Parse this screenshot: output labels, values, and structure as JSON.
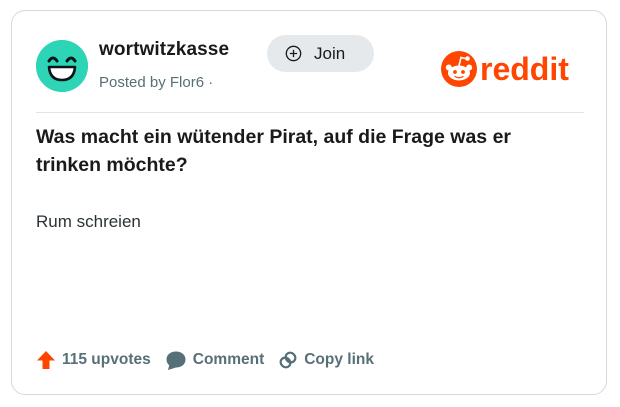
{
  "post": {
    "subreddit": "wortwitzkasse",
    "join_label": "Join",
    "posted_by": "Posted by Flor6 ·",
    "title": "Was macht ein wütender Pirat, auf die Frage was er trinken möchte?",
    "body": "Rum schreien"
  },
  "brand": {
    "logo_text": "reddit",
    "accent_color": "#ff4500",
    "avatar_color": "#2dd4b5"
  },
  "footer": {
    "upvotes_label": "115 upvotes",
    "comment_label": "Comment",
    "copy_link_label": "Copy link"
  },
  "icons": [
    "smiley-avatar-icon",
    "plus-circle-icon",
    "reddit-snoo-icon",
    "upvote-arrow-icon",
    "comment-bubble-icon",
    "link-icon"
  ]
}
